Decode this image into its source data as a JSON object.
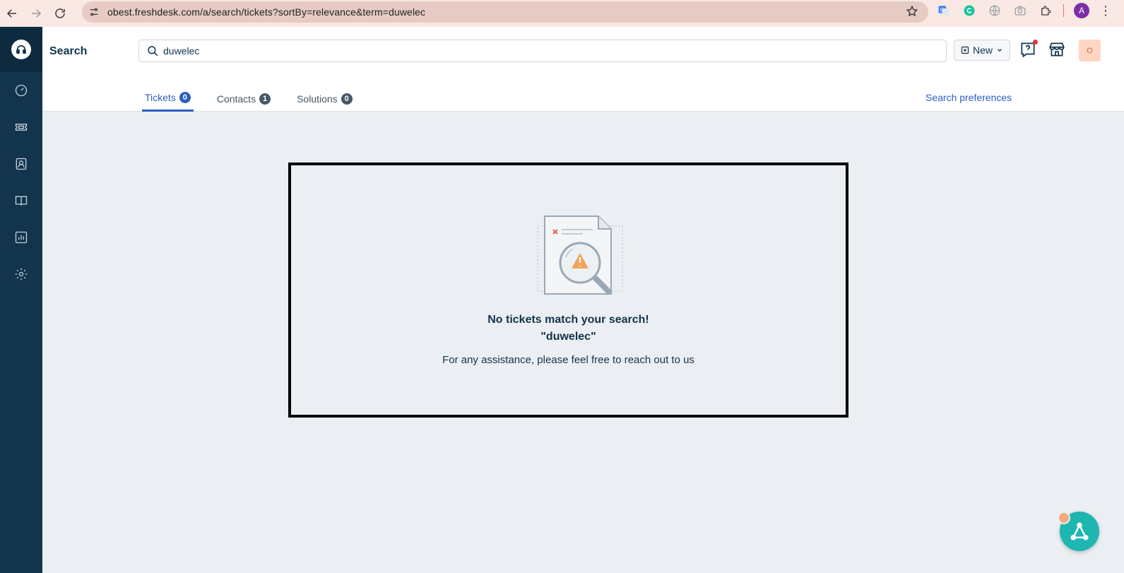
{
  "browser": {
    "url": "obest.freshdesk.com/a/search/tickets?sortBy=relevance&term=duwelec",
    "profile_initial": "A"
  },
  "header": {
    "page_title": "Search",
    "search_value": "duwelec",
    "new_label": "New",
    "user_initial": "O"
  },
  "tabs": [
    {
      "label": "Tickets",
      "count": "0",
      "active": true
    },
    {
      "label": "Contacts",
      "count": "1",
      "active": false
    },
    {
      "label": "Solutions",
      "count": "0",
      "active": false
    }
  ],
  "search_preferences_label": "Search preferences",
  "empty_state": {
    "title": "No tickets match your search!",
    "term": "\"duwelec\"",
    "help": "For any assistance, please feel free to reach out to us"
  },
  "colors": {
    "sidebar": "#12344d",
    "accent": "#2c5cc5",
    "background": "#ebeef2",
    "fab": "#1fb6b2"
  }
}
